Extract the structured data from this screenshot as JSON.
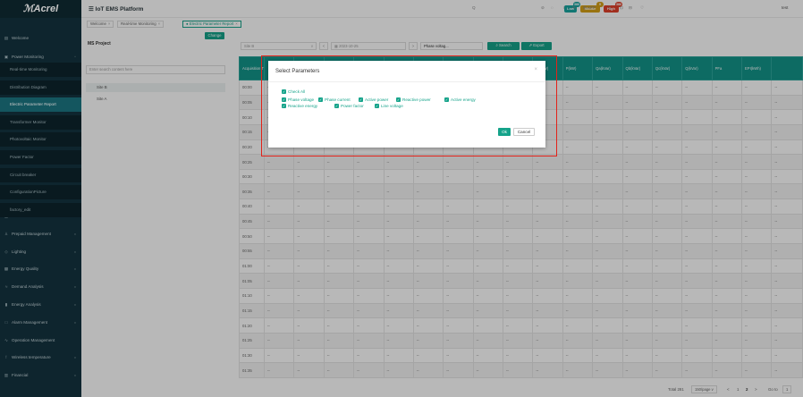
{
  "app": {
    "logo": "ℳAcrel",
    "title": "IoT EMS Platform"
  },
  "sidebar": {
    "items": [
      {
        "icon": "▤",
        "label": "Welcome",
        "chevron": ""
      },
      {
        "icon": "▣",
        "label": "Power Monitoring",
        "chevron": "^"
      },
      {
        "icon": "▦",
        "label": "Data Visualization",
        "chevron": "v"
      },
      {
        "icon": "⅄",
        "label": "Prepaid Management",
        "chevron": "v"
      },
      {
        "icon": "◇",
        "label": "Lighting",
        "chevron": "v"
      },
      {
        "icon": "▩",
        "label": "Energy Quality",
        "chevron": "v"
      },
      {
        "icon": "≈",
        "label": "Demand Analysis",
        "chevron": "v"
      },
      {
        "icon": "▮",
        "label": "Energy Analysis",
        "chevron": "v"
      },
      {
        "icon": "□",
        "label": "Alarm Management",
        "chevron": "v"
      },
      {
        "icon": "∿",
        "label": "Operation Management",
        "chevron": ""
      },
      {
        "icon": "⊺",
        "label": "Wireless temperature",
        "chevron": "v"
      },
      {
        "icon": "▥",
        "label": "Financial",
        "chevron": "v"
      }
    ],
    "subitems": [
      {
        "label": "Real-time Monitoring",
        "active": false
      },
      {
        "label": "Distribution Diagram",
        "active": false
      },
      {
        "label": "Electric Parameter Report",
        "active": true
      },
      {
        "label": "Transformer Monitor",
        "active": false
      },
      {
        "label": "Photovoltaic Monitor",
        "active": false
      },
      {
        "label": "Power Factor",
        "active": false
      },
      {
        "label": "Circuit breaker",
        "active": false
      },
      {
        "label": "ConfigurationPicture",
        "active": false
      },
      {
        "label": "factory_edit",
        "active": false
      }
    ]
  },
  "topbar": {
    "low": "Low",
    "low_count": "386",
    "middle": "Middle",
    "middle_count": "9",
    "high": "High",
    "high_count": "386",
    "icons": [
      "Q",
      "⊘",
      "◌",
      "≀",
      "%",
      "⊞ APP",
      "⠿",
      "⊡",
      "⊟",
      "♡"
    ],
    "user": "test"
  },
  "tabs": [
    {
      "label": "Welcome",
      "close": "×",
      "active": false
    },
    {
      "label": "Real-time Monitoring",
      "close": "×",
      "active": false
    },
    {
      "label": "● Electric Parameter Report",
      "close": "×",
      "active": true
    }
  ],
  "left_panel": {
    "title": "MS Project",
    "change_button": "Change",
    "search_placeholder": "Enter search content here",
    "sites": [
      "Site B",
      "Site A"
    ]
  },
  "filters": {
    "site": "Site B",
    "date": "2023-10-25",
    "param": "Phase voltag...",
    "search": "Search",
    "export": "Export"
  },
  "table": {
    "headers": [
      "Acquisition Time",
      "",
      "",
      "",
      "",
      "",
      "",
      "",
      "",
      "P(kW)",
      "Pc(kW)",
      "P(kW)",
      "Qa(kVar)",
      "Qb(kVar)",
      "Qc(kVar)",
      "Q(kVar)",
      "PFa",
      "EPI(kWh)",
      ""
    ],
    "times": [
      "00:00",
      "00:05",
      "00:10",
      "00:15",
      "00:20",
      "00:25",
      "00:30",
      "00:35",
      "00:40",
      "00:45",
      "00:50",
      "00:55",
      "01:00",
      "01:05",
      "01:10",
      "01:15",
      "01:20",
      "01:25",
      "01:30",
      "01:35"
    ],
    "empty": "--"
  },
  "modal": {
    "title": "Select Parameters",
    "close": "×",
    "check_all": "Check All",
    "params_row1": [
      "Phase voltage",
      "Phase current",
      "Active power",
      "Reactive power",
      "Active energy"
    ],
    "params_row2": [
      "Reactive energy",
      "Power factor",
      "Line voltage"
    ],
    "ok": "Ok",
    "cancel": "Cancel"
  },
  "pager": {
    "total": "Total 281",
    "per_page": "150/page",
    "pages": [
      "<",
      "1",
      "2",
      ">"
    ],
    "current": "2",
    "goto_label": "Go to",
    "goto_value": "1"
  },
  "colors": {
    "accent": "#15a38a",
    "low": "#1aa6a0",
    "middle": "#d4a017",
    "high": "#e0402a",
    "highlight": "#e2231a"
  }
}
